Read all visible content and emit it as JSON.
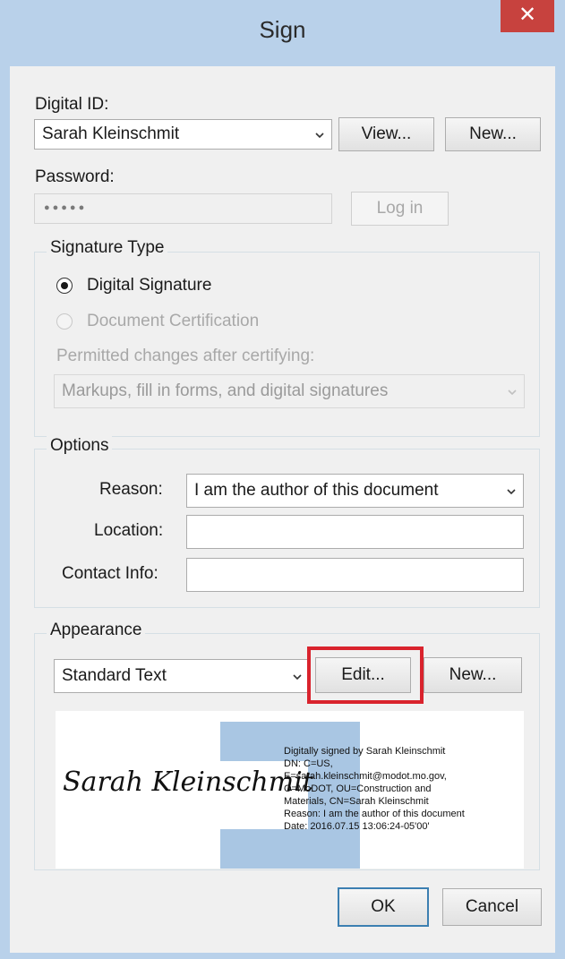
{
  "window": {
    "title": "Sign",
    "close_glyph": "✕"
  },
  "digital_id": {
    "label": "Digital ID:",
    "selected": "Sarah Kleinschmit",
    "view_label": "View...",
    "new_label": "New..."
  },
  "password": {
    "label": "Password:",
    "value": "●●●●●",
    "login_label": "Log in"
  },
  "signature_type": {
    "legend": "Signature Type",
    "digital_signature_label": "Digital Signature",
    "document_certification_label": "Document Certification",
    "permitted_changes_label": "Permitted changes after certifying:",
    "permitted_changes_value": "Markups, fill in forms, and digital signatures"
  },
  "options": {
    "legend": "Options",
    "reason_label": "Reason:",
    "reason_value": "I am the author of this document",
    "location_label": "Location:",
    "location_value": "",
    "contact_label": "Contact Info:",
    "contact_value": ""
  },
  "appearance": {
    "legend": "Appearance",
    "selected": "Standard Text",
    "edit_label": "Edit...",
    "new_label": "New...",
    "preview_signature": "Sarah Kleinschmit",
    "preview_text": "Digitally signed by Sarah Kleinschmit\nDN: C=US,\nE=sarah.kleinschmit@modot.mo.gov,\nO=MoDOT, OU=Construction and\nMaterials, CN=Sarah Kleinschmit\nReason: I am the author of this document\nDate: 2016.07.15 13:06:24-05'00'"
  },
  "footer": {
    "ok_label": "OK",
    "cancel_label": "Cancel"
  },
  "colors": {
    "frame": "#b9d1ea",
    "close": "#c7423e",
    "highlight": "#d9232d",
    "watermark": "#a9c6e3"
  },
  "icons": {
    "dropdown": "chevron-down-icon",
    "close": "close-icon"
  }
}
